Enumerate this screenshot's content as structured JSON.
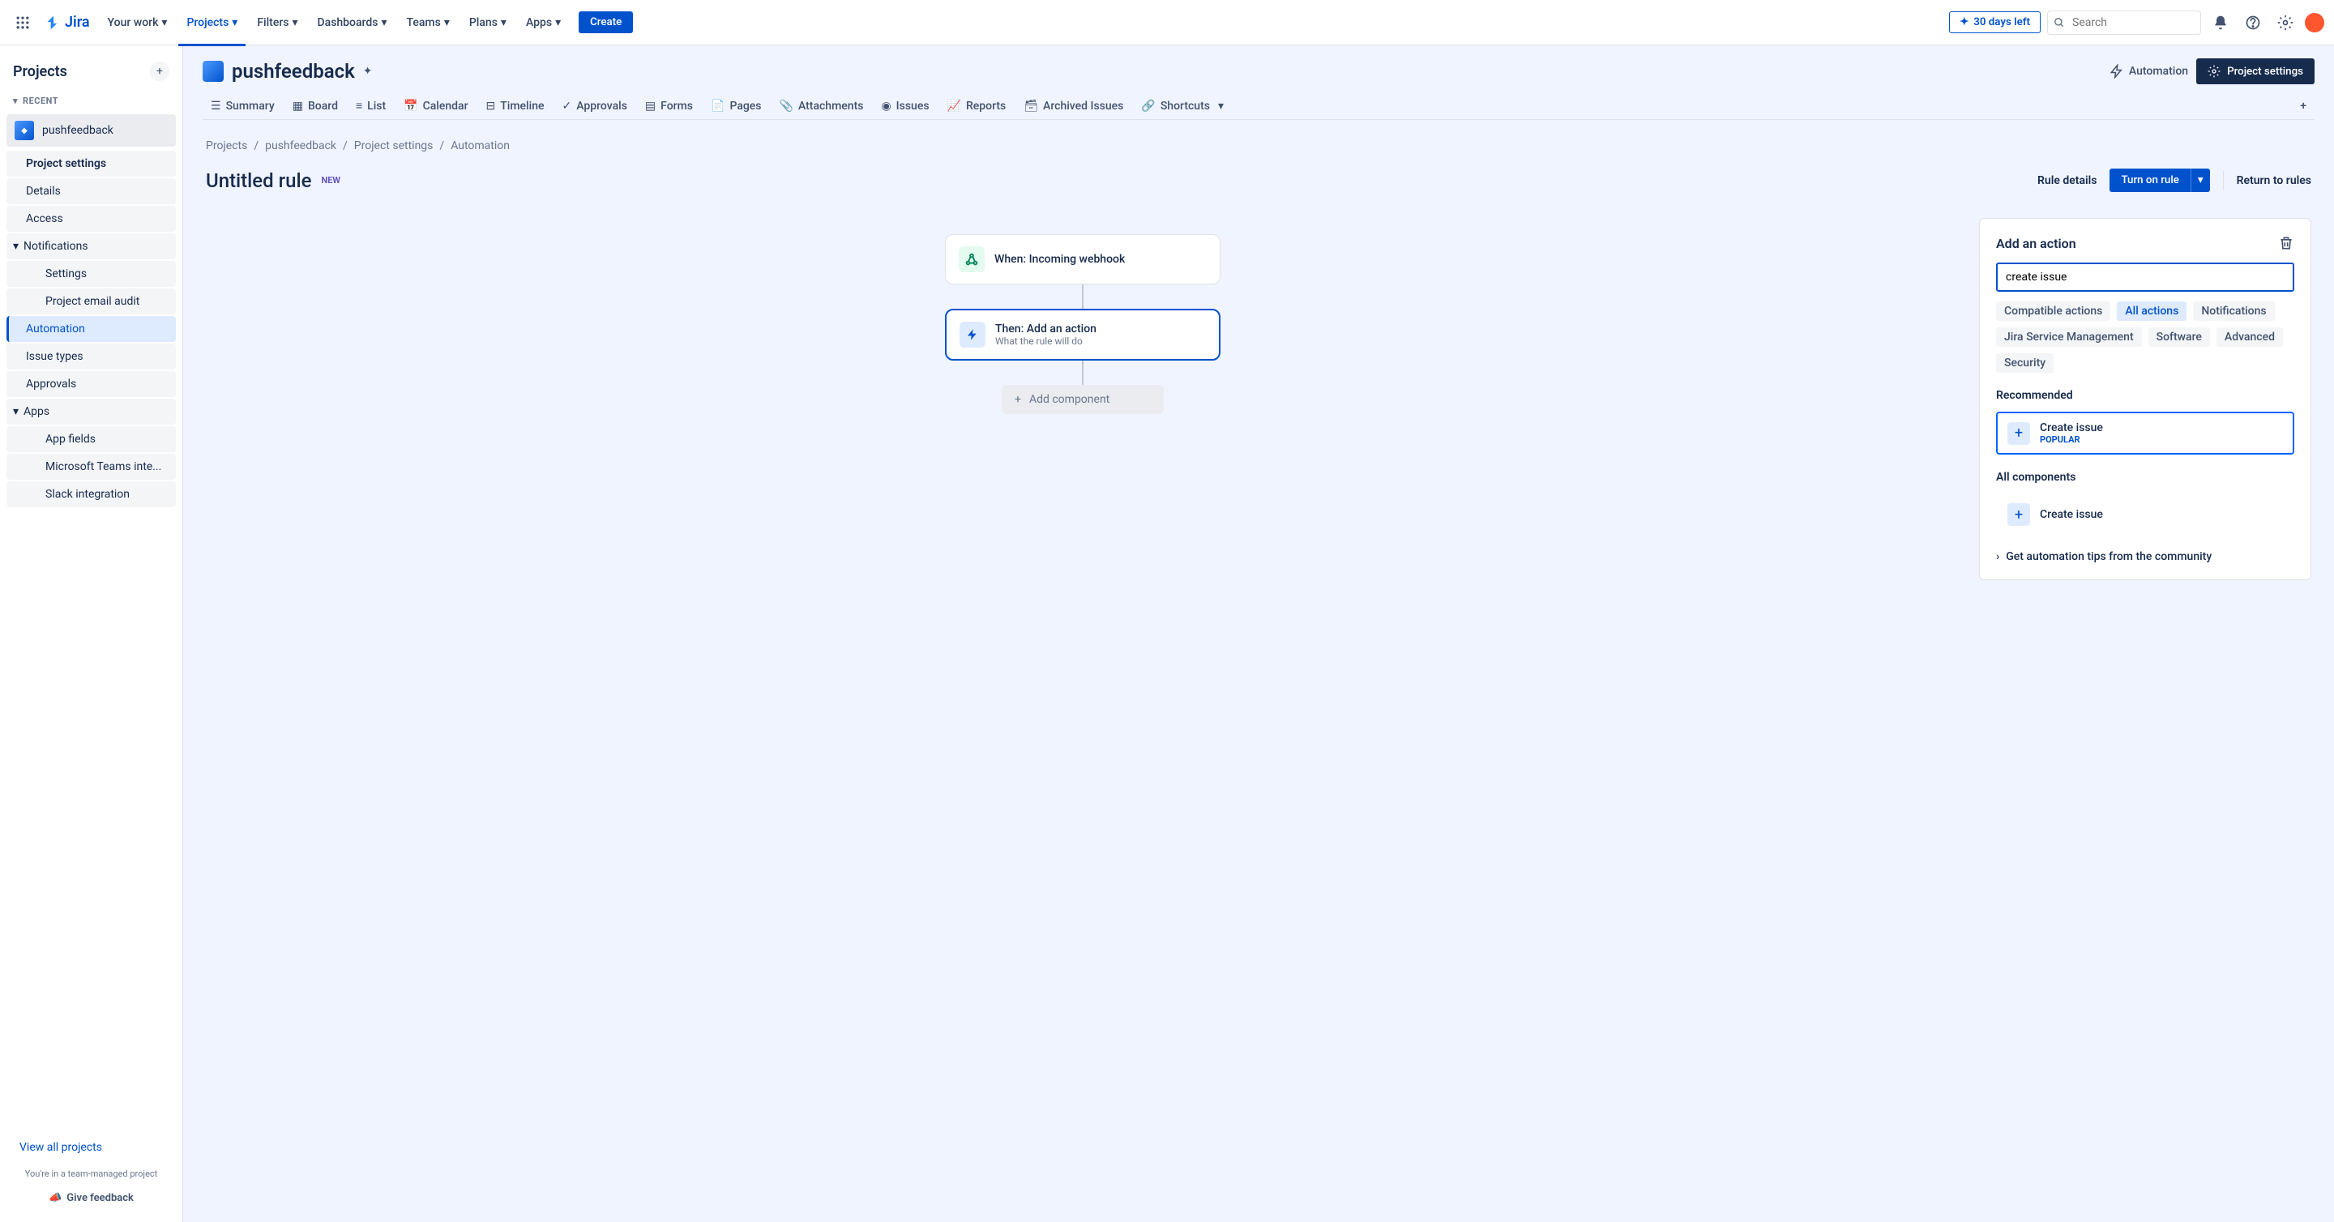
{
  "topnav": {
    "logo": "Jira",
    "items": [
      "Your work",
      "Projects",
      "Filters",
      "Dashboards",
      "Teams",
      "Plans",
      "Apps"
    ],
    "create": "Create",
    "days_left": "30 days left",
    "search_placeholder": "Search"
  },
  "sidebar": {
    "title": "Projects",
    "recent_label": "Recent",
    "project": "pushfeedback",
    "items": {
      "project_settings": "Project settings",
      "details": "Details",
      "access": "Access",
      "notifications": "Notifications",
      "settings": "Settings",
      "email_audit": "Project email audit",
      "automation": "Automation",
      "issue_types": "Issue types",
      "approvals": "Approvals",
      "apps": "Apps",
      "app_fields": "App fields",
      "teams": "Microsoft Teams inte...",
      "slack": "Slack integration"
    },
    "view_all": "View all projects",
    "managed_text": "You're in a team-managed project",
    "feedback": "Give feedback"
  },
  "header": {
    "project_name": "pushfeedback",
    "automation_btn": "Automation",
    "settings_btn": "Project settings",
    "tabs": [
      "Summary",
      "Board",
      "List",
      "Calendar",
      "Timeline",
      "Approvals",
      "Forms",
      "Pages",
      "Attachments",
      "Issues",
      "Reports",
      "Archived Issues",
      "Shortcuts"
    ]
  },
  "breadcrumbs": [
    "Projects",
    "pushfeedback",
    "Project settings",
    "Automation"
  ],
  "rule": {
    "title": "Untitled rule",
    "new_badge": "NEW",
    "rule_details": "Rule details",
    "turn_on": "Turn on rule",
    "return": "Return to rules"
  },
  "flow": {
    "when_label": "When: Incoming webhook",
    "then_label": "Then: Add an action",
    "then_sub": "What the rule will do",
    "add_component": "Add component"
  },
  "panel": {
    "title": "Add an action",
    "search_value": "create issue",
    "chips": [
      "Compatible actions",
      "All actions",
      "Notifications",
      "Jira Service Management",
      "Software",
      "Advanced",
      "Security"
    ],
    "recommended_label": "Recommended",
    "create_issue": "Create issue",
    "popular": "POPULAR",
    "all_components_label": "All components",
    "create_issue2": "Create issue",
    "tips": "Get automation tips from the community"
  }
}
